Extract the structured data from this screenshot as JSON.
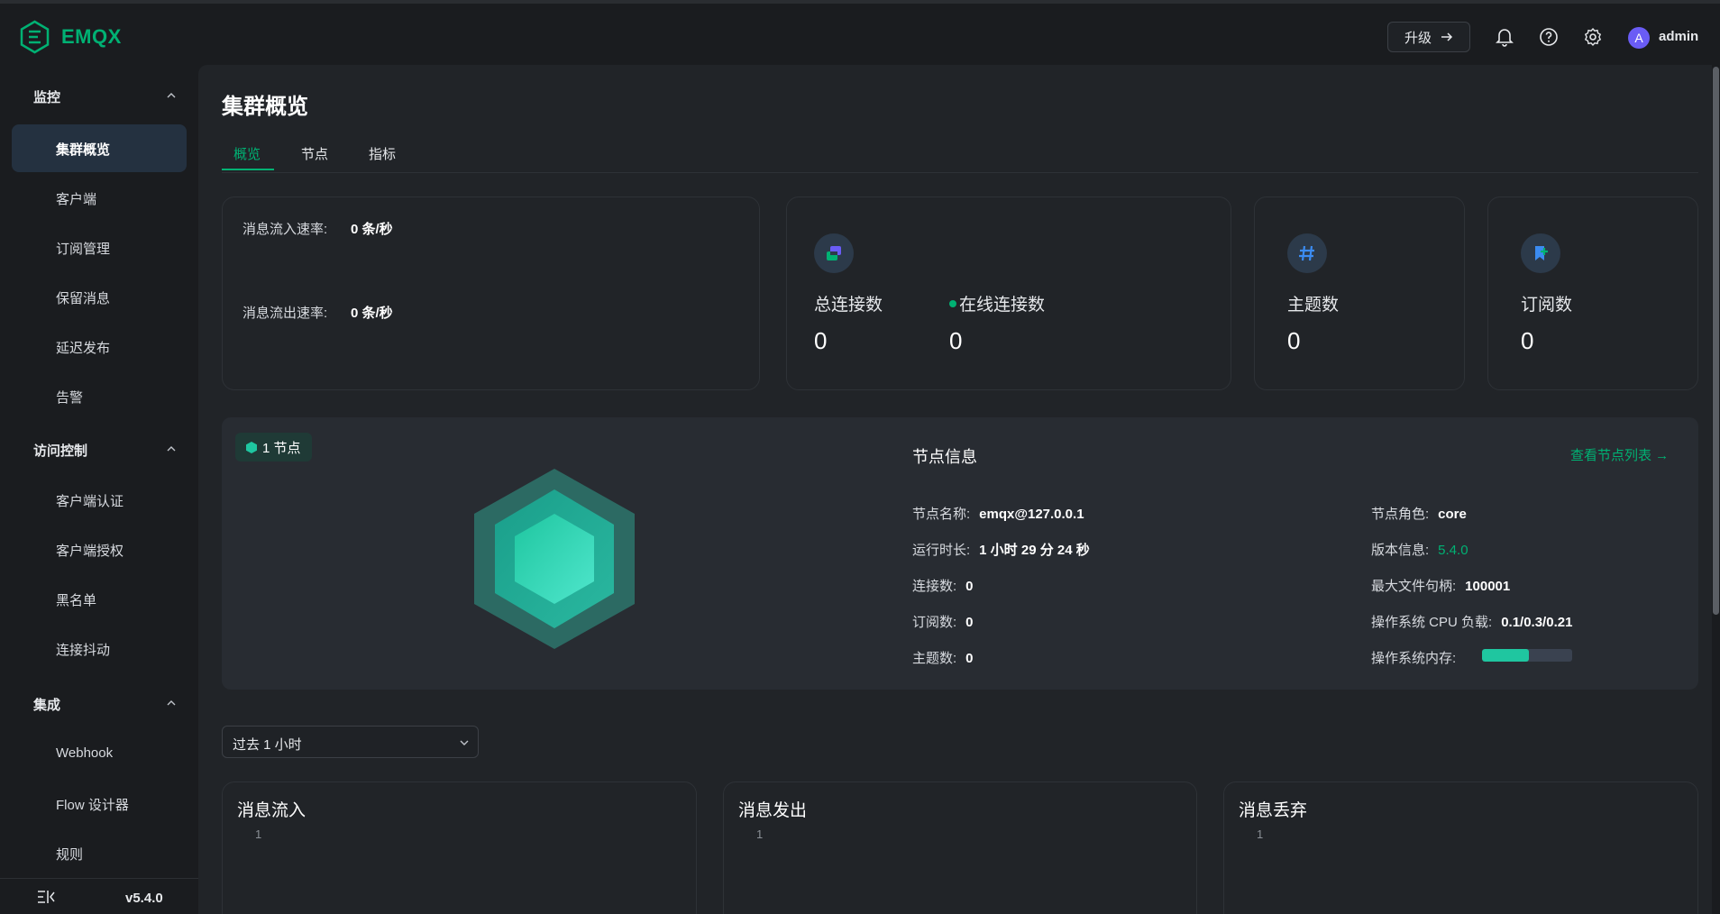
{
  "app": {
    "name": "EMQX"
  },
  "header": {
    "upgrade_label": "升级",
    "username": "admin",
    "avatar_letter": "A"
  },
  "sidebar": {
    "groups": [
      {
        "label": "监控",
        "items": [
          "集群概览",
          "客户端",
          "订阅管理",
          "保留消息",
          "延迟发布",
          "告警"
        ]
      },
      {
        "label": "访问控制",
        "items": [
          "客户端认证",
          "客户端授权",
          "黑名单",
          "连接抖动"
        ]
      },
      {
        "label": "集成",
        "items": [
          "Webhook",
          "Flow 设计器",
          "规则"
        ]
      }
    ],
    "active_item": "集群概览",
    "version": "v5.4.0"
  },
  "page": {
    "title": "集群概览",
    "tabs": [
      "概览",
      "节点",
      "指标"
    ],
    "active_tab": "概览"
  },
  "rates": {
    "in_label": "消息流入速率:",
    "in_value": "0 条/秒",
    "out_label": "消息流出速率:",
    "out_value": "0 条/秒"
  },
  "stats": {
    "total_conn_label": "总连接数",
    "total_conn_value": "0",
    "online_conn_label": "在线连接数",
    "online_conn_value": "0",
    "topics_label": "主题数",
    "topics_value": "0",
    "subs_label": "订阅数",
    "subs_value": "0"
  },
  "node_panel": {
    "badge": "1 节点",
    "info_title": "节点信息",
    "list_link": "查看节点列表",
    "left": [
      {
        "k": "节点名称:",
        "v": "emqx@127.0.0.1"
      },
      {
        "k": "运行时长:",
        "v": "1 小时 29 分 24 秒"
      },
      {
        "k": "连接数:",
        "v": "0"
      },
      {
        "k": "订阅数:",
        "v": "0"
      },
      {
        "k": "主题数:",
        "v": "0"
      }
    ],
    "right": [
      {
        "k": "节点角色:",
        "v": "core"
      },
      {
        "k": "版本信息:",
        "v": "5.4.0"
      },
      {
        "k": "最大文件句柄:",
        "v": "100001"
      },
      {
        "k": "操作系统 CPU 负载:",
        "v": "0.1/0.3/0.21"
      },
      {
        "k": "操作系统内存:",
        "v": ""
      }
    ],
    "memory_fraction": 0.52,
    "colors": {
      "accent": "#00b173",
      "hex_outer": "#2c6a63",
      "hex_mid": "#1e9e8a",
      "hex_inner": "#3fe0c4"
    }
  },
  "time_range": {
    "selected": "过去 1 小时"
  },
  "charts": [
    {
      "title": "消息流入",
      "tick": "1"
    },
    {
      "title": "消息发出",
      "tick": "1"
    },
    {
      "title": "消息丢弃",
      "tick": "1"
    }
  ]
}
